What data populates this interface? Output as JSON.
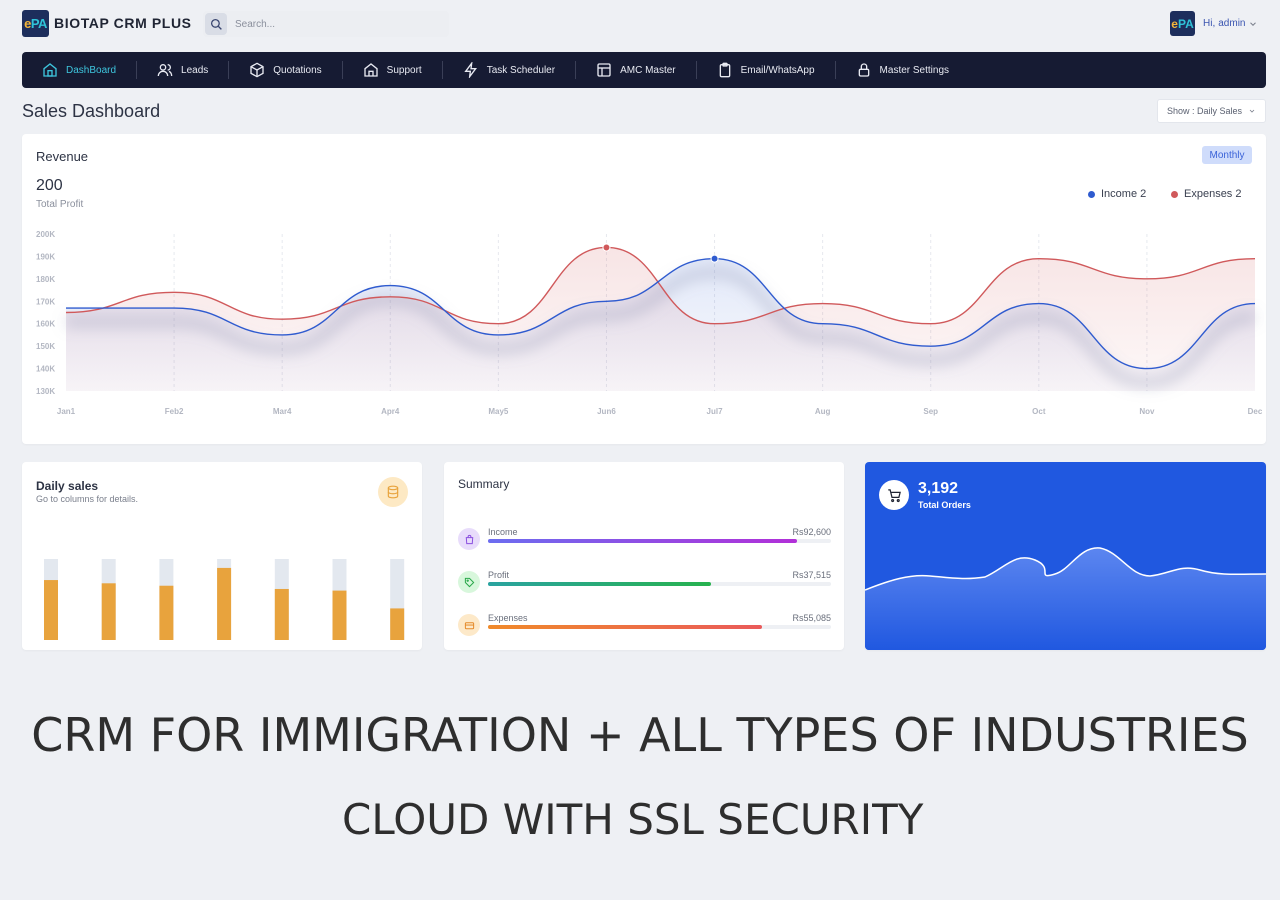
{
  "app": {
    "logo_e": "e",
    "logo_pa": "PA",
    "brand": "BIOTAP CRM PLUS",
    "search_placeholder": "Search...",
    "greeting_prefix": "Hi,",
    "user_name": "admin"
  },
  "nav": {
    "items": [
      {
        "label": "DashBoard",
        "icon": "home-icon"
      },
      {
        "label": "Leads",
        "icon": "users-icon"
      },
      {
        "label": "Quotations",
        "icon": "box-icon"
      },
      {
        "label": "Support",
        "icon": "home-outline-icon"
      },
      {
        "label": "Task Scheduler",
        "icon": "bolt-icon"
      },
      {
        "label": "AMC Master",
        "icon": "layout-icon"
      },
      {
        "label": "Email/WhatsApp",
        "icon": "clipboard-icon"
      },
      {
        "label": "Master Settings",
        "icon": "lock-icon"
      }
    ],
    "active": "DashBoard"
  },
  "page": {
    "title": "Sales Dashboard",
    "show_select": "Show : Daily Sales"
  },
  "revenue": {
    "title": "Revenue",
    "period_button": "Monthly",
    "total_value": "200",
    "total_label": "Total Profit",
    "legend": [
      {
        "name": "Income 2",
        "color": "#2f5bcf"
      },
      {
        "name": "Expenses 2",
        "color": "#d0595b"
      }
    ]
  },
  "chart_data": {
    "type": "line",
    "x": [
      "Jan1",
      "Feb2",
      "Mar4",
      "Apr4",
      "May5",
      "Jun6",
      "Jul7",
      "Aug",
      "Sep",
      "Oct",
      "Nov",
      "Dec"
    ],
    "series": [
      {
        "name": "Income 2",
        "color": "#2f5bcf",
        "values": [
          167,
          167,
          155,
          177,
          155,
          170,
          189,
          160,
          150,
          169,
          140,
          169
        ]
      },
      {
        "name": "Expenses 2",
        "color": "#d0595b",
        "values": [
          165,
          174,
          162,
          172,
          160,
          194,
          160,
          169,
          160,
          189,
          180,
          189
        ]
      }
    ],
    "yticks": [
      "130K",
      "140K",
      "150K",
      "160K",
      "170K",
      "180K",
      "190K",
      "200K"
    ],
    "ylim": [
      130,
      200
    ],
    "highlight_points": [
      {
        "series": "Expenses 2",
        "x": "Jun6",
        "value": 194
      },
      {
        "series": "Income 2",
        "x": "Jul7",
        "value": 189
      }
    ],
    "grid": "vertical-dashed"
  },
  "daily_sales": {
    "title": "Daily sales",
    "subtitle": "Go to columns for details.",
    "icon": "database-icon",
    "bar_color": "#e8a33d",
    "track_color": "#e3e8ef",
    "values": [
      0.74,
      0.7,
      0.67,
      0.89,
      0.63,
      0.61,
      0.39
    ]
  },
  "summary": {
    "title": "Summary",
    "rows": [
      {
        "label": "Income",
        "value": "Rs92,600",
        "fraction": 0.9,
        "icon": "bag-icon",
        "icon_bg": "#e8dcfb",
        "icon_color": "#8a4fe0",
        "fill": "linear-gradient(90deg,#6c6df0,#b22fd8)"
      },
      {
        "label": "Profit",
        "value": "Rs37,515",
        "fraction": 0.65,
        "icon": "tag-icon",
        "icon_bg": "#d8f7dc",
        "icon_color": "#2aa84a",
        "fill": "linear-gradient(90deg,#2aa3a0,#27b24e)"
      },
      {
        "label": "Expenses",
        "value": "Rs55,085",
        "fraction": 0.8,
        "icon": "card-icon",
        "icon_bg": "#fde9c9",
        "icon_color": "#e58a2a",
        "fill": "linear-gradient(90deg,#f08a2a,#ea5a5a)"
      }
    ]
  },
  "orders": {
    "value": "3,192",
    "label": "Total Orders",
    "icon": "cart-icon"
  },
  "banner": {
    "line1": "CRM FOR IMMIGRATION + ALL TYPES OF INDUSTRIES",
    "line2": "CLOUD WITH SSL SECURITY"
  }
}
